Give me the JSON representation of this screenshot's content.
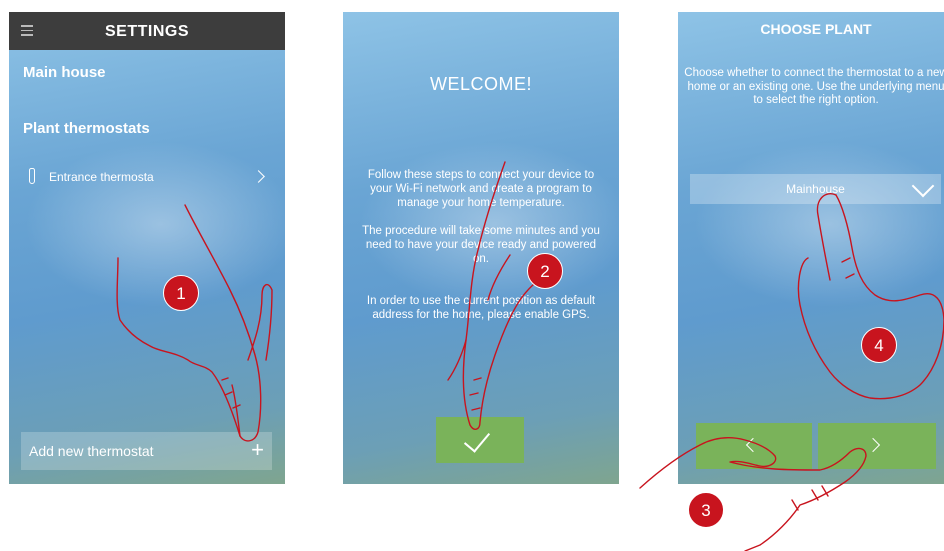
{
  "screen1": {
    "title": "SETTINGS",
    "section_house": "Main house",
    "section_plant": "Plant thermostats",
    "thermostat_item": "Entrance thermosta",
    "add_button": "Add new thermostat"
  },
  "screen2": {
    "title": "WELCOME!",
    "paragraph1": "Follow these steps to connect your device to your Wi-Fi network and create a program to manage your home temperature.",
    "paragraph2": "The procedure will take some minutes and you need to have your device ready and powered on.",
    "paragraph3": "In order to use the current position as default address for the home, please enable GPS."
  },
  "screen3": {
    "title": "CHOOSE PLANT",
    "instructions": "Choose whether to connect the thermostat to a new home or an existing one. Use the underlying menu to select the right option.",
    "selected_plant": "Mainhouse"
  },
  "steps": [
    "1",
    "2",
    "3",
    "4"
  ],
  "colors": {
    "topbar": "#3d3d3d",
    "confirm_green": "#7ab35a",
    "step_badge": "#c8141e",
    "hand_outline": "#c8141e"
  },
  "icons": [
    "menu-icon",
    "thermometer-icon",
    "chevron-right-icon",
    "plus-icon",
    "checkmark-icon",
    "chevron-down-icon",
    "chevron-left-icon"
  ]
}
